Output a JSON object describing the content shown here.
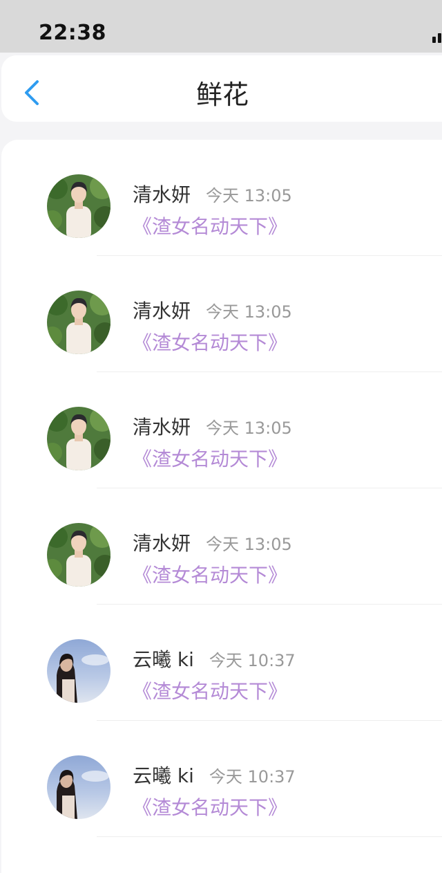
{
  "status_bar": {
    "time": "22:38"
  },
  "header": {
    "title": "鲜花",
    "back_icon": "chevron-left-icon"
  },
  "colors": {
    "accent_blue": "#2f9cf0",
    "book_purple": "#b48ad6",
    "time_gray": "#999999"
  },
  "items": [
    {
      "name": "清水妍",
      "time": "今天 13:05",
      "book": "《渣女名动天下》"
    },
    {
      "name": "清水妍",
      "time": "今天 13:05",
      "book": "《渣女名动天下》"
    },
    {
      "name": "清水妍",
      "time": "今天 13:05",
      "book": "《渣女名动天下》"
    },
    {
      "name": "清水妍",
      "time": "今天 13:05",
      "book": "《渣女名动天下》"
    },
    {
      "name": "云曦 ki",
      "time": "今天 10:37",
      "book": "《渣女名动天下》"
    },
    {
      "name": "云曦 ki",
      "time": "今天 10:37",
      "book": "《渣女名动天下》"
    }
  ]
}
